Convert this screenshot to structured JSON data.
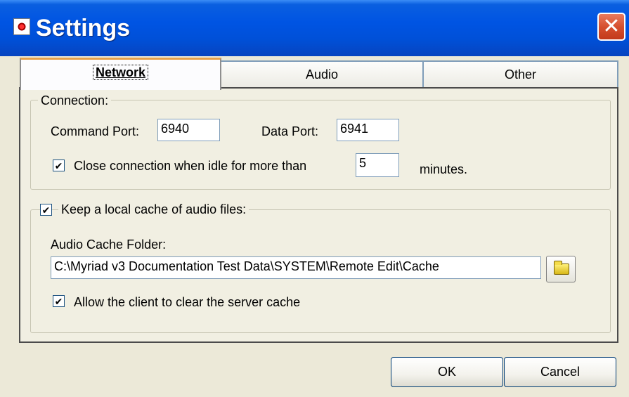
{
  "window": {
    "title": "Settings",
    "close_glyph": "✕"
  },
  "tabs": [
    {
      "label": "Network",
      "active": true
    },
    {
      "label": "Audio",
      "active": false
    },
    {
      "label": "Other",
      "active": false
    }
  ],
  "connection": {
    "legend": "Connection:",
    "command_port_label": "Command Port:",
    "command_port_value": "6940",
    "data_port_label": "Data Port:",
    "data_port_value": "6941",
    "close_idle_checked": true,
    "close_idle_label": "Close connection when idle for more than",
    "idle_minutes_value": "5",
    "minutes_label": "minutes."
  },
  "cache": {
    "keep_cache_checked": true,
    "keep_cache_label": "Keep a local cache of audio files:",
    "folder_label": "Audio Cache Folder:",
    "folder_value": "C:\\Myriad v3 Documentation Test Data\\SYSTEM\\Remote Edit\\Cache",
    "browse_icon": "folder-icon",
    "allow_clear_checked": true,
    "allow_clear_label": "Allow the client to clear the server cache"
  },
  "buttons": {
    "ok": "OK",
    "cancel": "Cancel"
  },
  "colors": {
    "titlebar": "#0054e3",
    "close_button": "#d6502f",
    "active_tab_accent": "#e6a14a",
    "dialog_bg": "#ece9d8"
  }
}
